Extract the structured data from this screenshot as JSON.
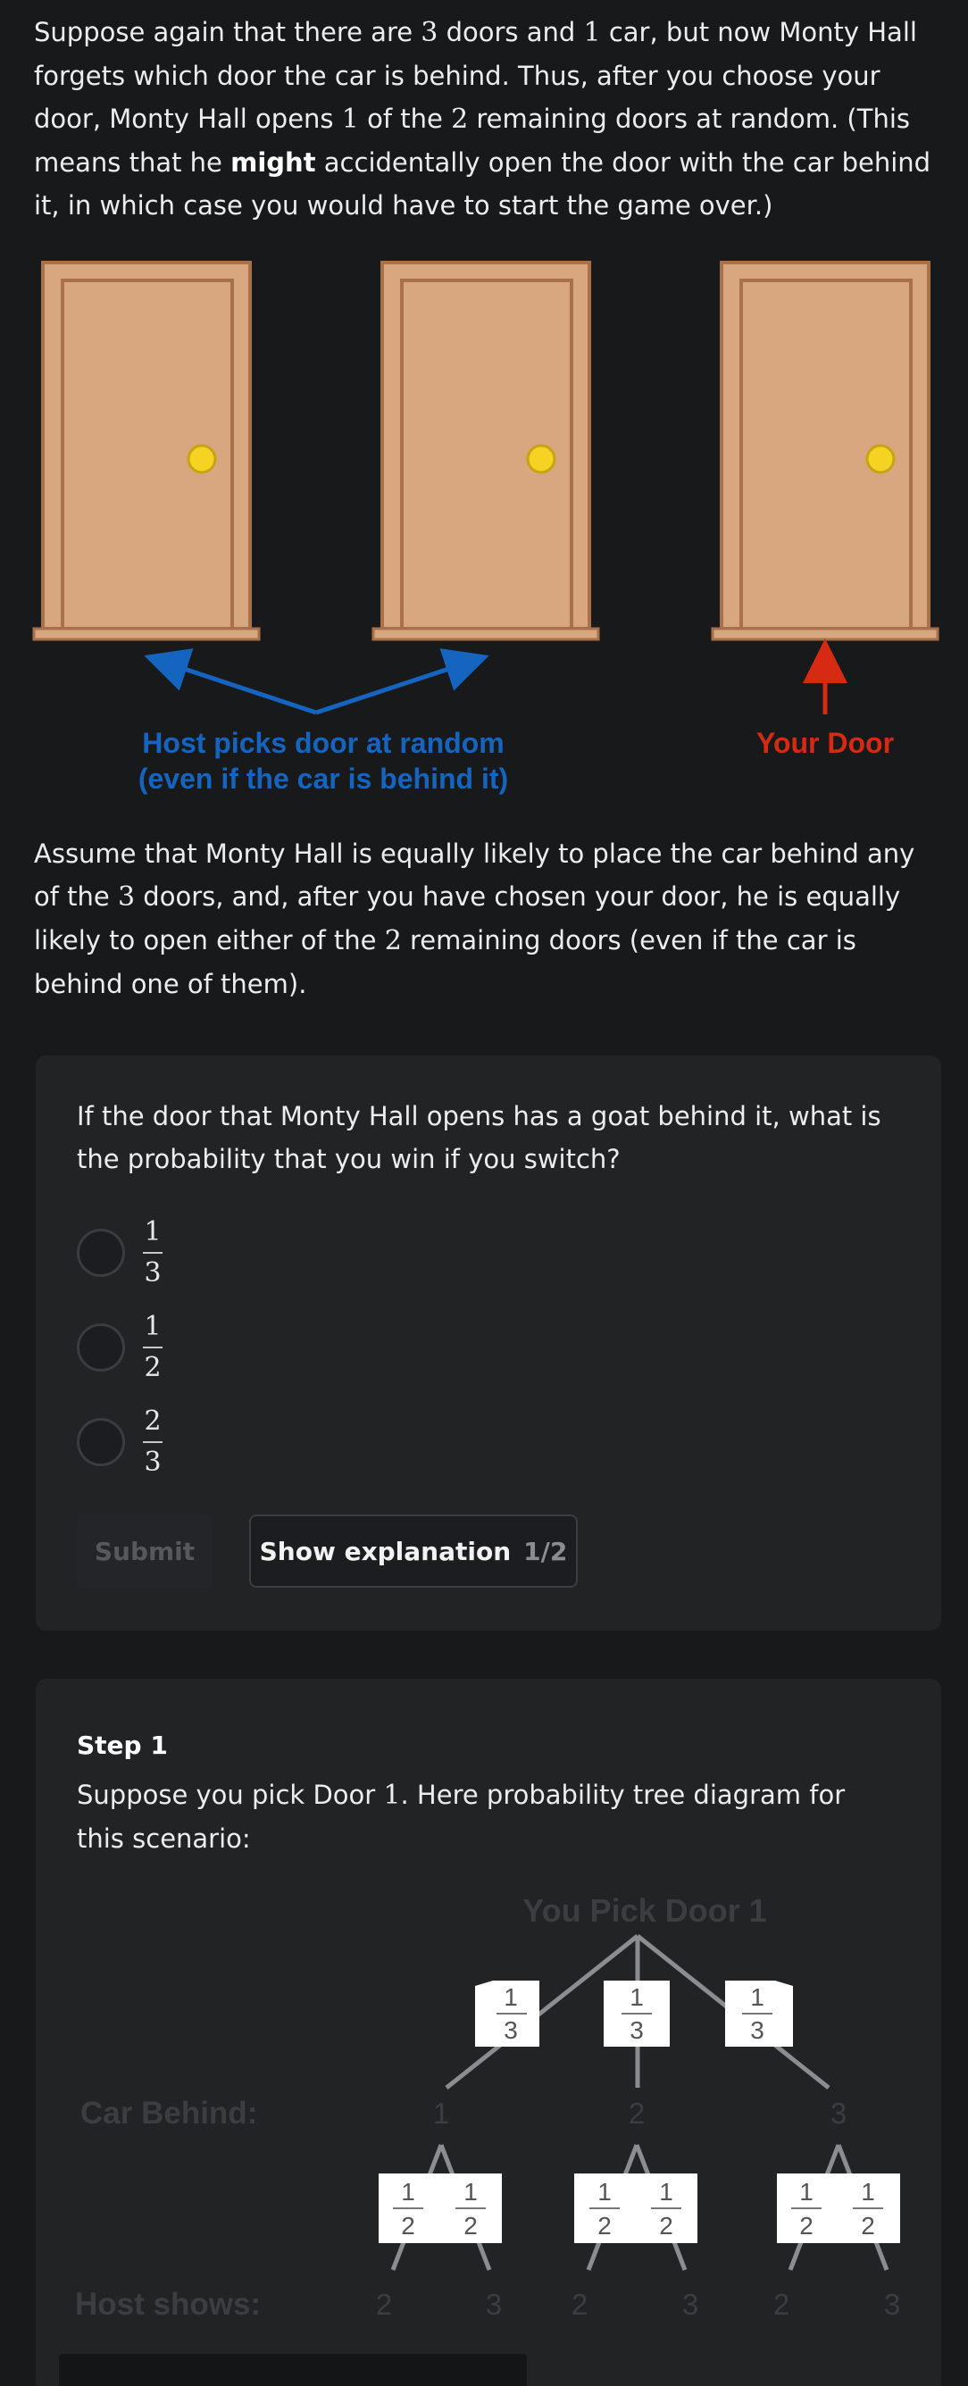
{
  "intro": {
    "t1": "Suppose again that there are ",
    "n3": "3",
    "t2": " doors and ",
    "n1": "1",
    "t3": " car, but now Monty Hall forgets which door the car is behind. Thus, after you choose your door, Monty Hall opens ",
    "n1b": "1",
    "t4": " of the ",
    "n2": "2",
    "t5": " remaining doors at random. (This means that he ",
    "bold": "might",
    "t6": " accidentally open the door with the car behind it, in which case you would have to start the game over.)"
  },
  "figure": {
    "host_label_1": "Host picks door at random",
    "host_label_2": "(even if the car is behind it)",
    "your_door_label": "Your Door",
    "colors": {
      "door": "#d9a77f",
      "door_border": "#a8714a",
      "knob": "#f5d322",
      "blue": "#1565c0",
      "red": "#d62a12"
    }
  },
  "assume": {
    "t1": "Assume that Monty Hall is equally likely to place the car behind any of the ",
    "n3": "3",
    "t2": " doors, and, after you have chosen your door, he is equally likely to open either of the ",
    "n2": "2",
    "t3": " remaining doors (even if the car is behind one of them)."
  },
  "question": {
    "text": "If the door that Monty Hall opens has a goat behind it, what is the probability that you win if you switch?",
    "choices": [
      {
        "num": "1",
        "den": "3"
      },
      {
        "num": "1",
        "den": "2"
      },
      {
        "num": "2",
        "den": "3"
      }
    ],
    "submit_label": "Submit",
    "explanation_label": "Show explanation",
    "explanation_count": "1/2"
  },
  "step": {
    "title": "Step 1",
    "t1": "Suppose you pick Door ",
    "n1": "1",
    "t2": ". Here probability tree diagram for this scenario:"
  },
  "tree": {
    "root_label": "You Pick Door 1",
    "car_behind_label": "Car Behind:",
    "host_shows_label": "Host shows:",
    "car_doors": [
      "1",
      "2",
      "3"
    ],
    "first_branch": {
      "num": "1",
      "den": "3"
    },
    "second_branch": {
      "num": "1",
      "den": "2"
    },
    "host_doors": [
      "2",
      "3",
      "2",
      "3",
      "2",
      "3"
    ]
  }
}
